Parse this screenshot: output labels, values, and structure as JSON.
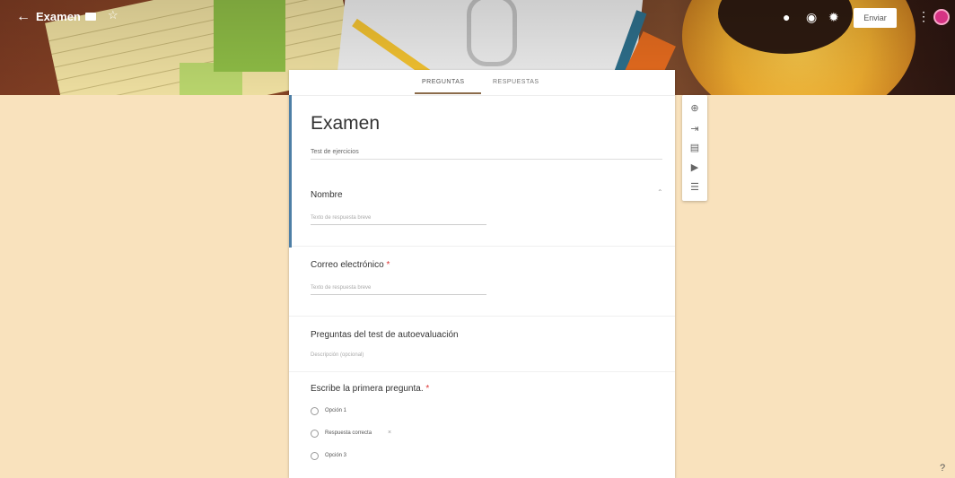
{
  "header": {
    "back_icon": "arrow-left-icon",
    "title": "Examen",
    "folder_icon": "folder-icon",
    "star_icon": "star-icon",
    "palette_icon": "palette-icon",
    "preview_icon": "eye-icon",
    "settings_icon": "gear-icon",
    "send_label": "Enviar",
    "more_icon": "more-vert-icon",
    "avatar_color": "#d63384"
  },
  "tabs": [
    {
      "label": "PREGUNTAS",
      "active": true
    },
    {
      "label": "RESPUESTAS",
      "active": false
    }
  ],
  "form": {
    "title": "Examen",
    "description": "Test de ejercicios",
    "questions": [
      {
        "title": "Nombre",
        "required": false,
        "placeholder": "Texto de respuesta breve"
      },
      {
        "title": "Correo electrónico",
        "required": true,
        "placeholder": "Texto de respuesta breve"
      }
    ],
    "section": {
      "title": "Preguntas del test de autoevaluación",
      "description": "Descripción (opcional)"
    },
    "mc_question": {
      "title": "Escribe la primera pregunta.",
      "required": true,
      "options": [
        "Opción 1",
        "Respuesta correcta",
        "Opción 3"
      ]
    }
  },
  "toolbar": [
    "add-question-icon",
    "import-questions-icon",
    "add-title-icon",
    "add-video-icon",
    "add-section-icon"
  ],
  "colors": {
    "background": "#f9e2bd",
    "accent": "#4e7fa6",
    "tab_indicator": "#8b6b4a"
  }
}
